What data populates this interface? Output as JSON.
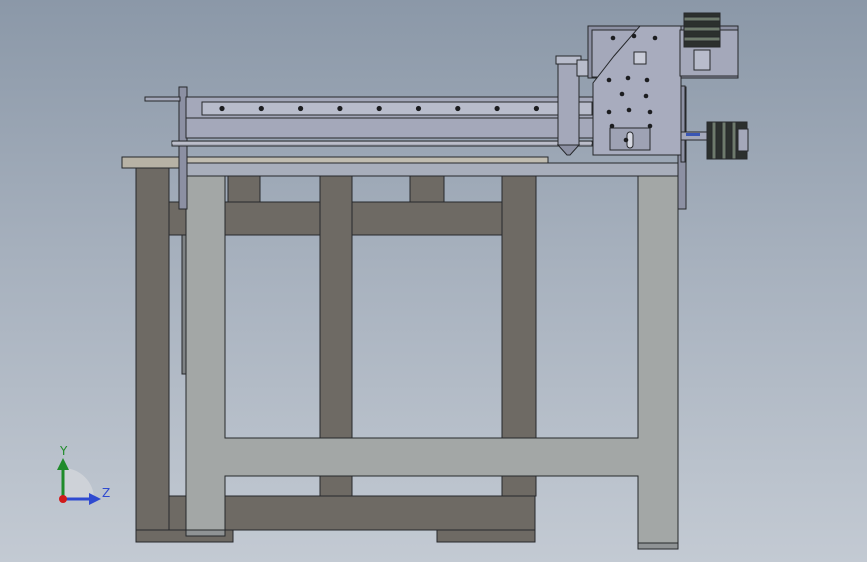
{
  "viewport": {
    "background_top": "#8b98a8",
    "background_bottom": "#c3cad3"
  },
  "colors": {
    "frame_dark": "#6e6a64",
    "frame_light": "#a3a7a6",
    "frame_outline": "#26282b",
    "gantry_metal": "#a4a8ba",
    "gantry_shadow": "#8c90a3",
    "motor_dark": "#2c302e",
    "motor_band": "#6e7a6c",
    "accent_blue": "#3a56b5",
    "axis_y": "#1f8b2a",
    "axis_z": "#2f4ad0",
    "axis_origin": "#d11a1a"
  },
  "triad": {
    "y_label": "Y",
    "z_label": "Z"
  }
}
